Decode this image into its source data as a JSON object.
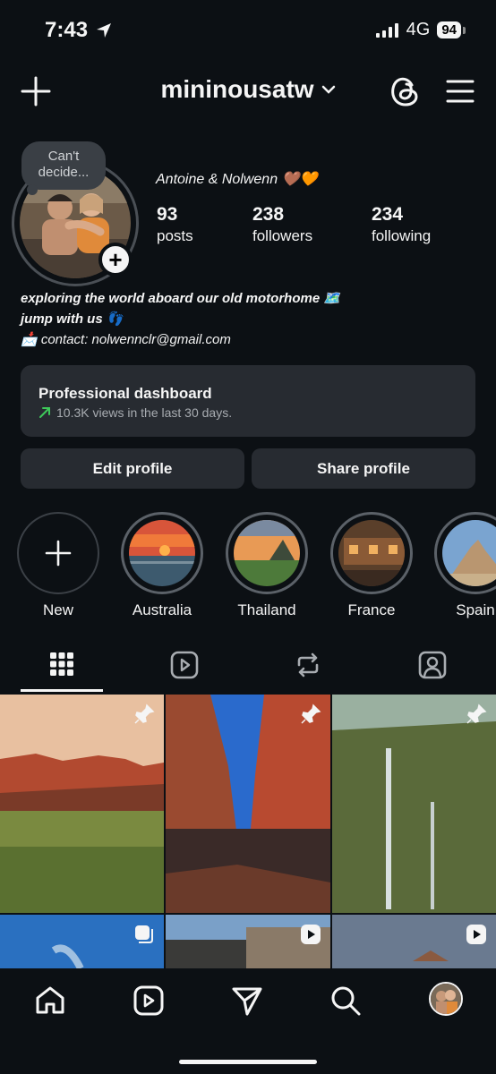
{
  "status_bar": {
    "time": "7:43",
    "network": "4G",
    "battery": "94"
  },
  "header": {
    "username": "mininousatw"
  },
  "profile": {
    "note": "Can't decide...",
    "full_name": "Antoine & Nolwenn 🤎🧡",
    "stats": {
      "posts": {
        "value": "93",
        "label": "posts"
      },
      "followers": {
        "value": "238",
        "label": "followers"
      },
      "following": {
        "value": "234",
        "label": "following"
      }
    },
    "bio": {
      "line1": "exploring the world aboard our old motorhome 🗺️",
      "line2": "jump with us 👣",
      "line3": "📩 contact: nolwennclr@gmail.com"
    }
  },
  "dashboard": {
    "title": "Professional dashboard",
    "subtitle": "10.3K views in the last 30 days."
  },
  "buttons": {
    "edit": "Edit profile",
    "share": "Share profile"
  },
  "highlights": [
    {
      "label": "New"
    },
    {
      "label": "Australia"
    },
    {
      "label": "Thailand"
    },
    {
      "label": "France"
    },
    {
      "label": "Spain"
    }
  ],
  "tabs": [
    "grid-icon",
    "reels-icon",
    "reposts-icon",
    "tagged-icon"
  ],
  "nav": [
    "home-icon",
    "reels-icon",
    "messages-icon",
    "search-icon",
    "profile-avatar"
  ],
  "colors": {
    "background": "#0c1014",
    "card": "#272b31",
    "accent_green": "#3ec95a"
  }
}
